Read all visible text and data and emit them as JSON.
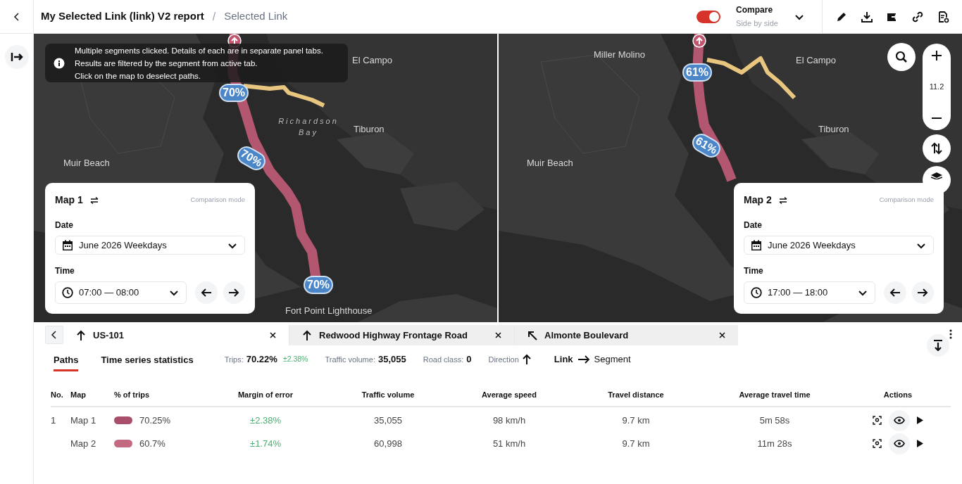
{
  "header": {
    "title": "My Selected Link (link) V2 report",
    "separator": "/",
    "breadcrumb": "Selected Link",
    "compare": {
      "on": true,
      "label": "Compare",
      "mode": "Side by side"
    }
  },
  "notice": {
    "lines": [
      "Multiple segments clicked. Details of each are in separate panel tabs.",
      "Results are filtered by the segment from active tab.",
      "Click on the map to deselect paths."
    ]
  },
  "maps": [
    {
      "name": "Map 1",
      "mode_label": "Comparison mode",
      "date_label": "Date",
      "date": "June 2026 Weekdays",
      "time_label": "Time",
      "time": "07:00 — 08:00",
      "places": [
        "El Campo",
        "Richardson Bay",
        "Tiburon",
        "Muir Beach",
        "Fort Point Lighthouse"
      ],
      "percent_labels": [
        "70%",
        "70%",
        "70%"
      ]
    },
    {
      "name": "Map 2",
      "mode_label": "Comparison mode",
      "date_label": "Date",
      "date": "June 2026 Weekdays",
      "time_label": "Time",
      "time": "17:00 — 18:00",
      "places": [
        "Miller Molino",
        "El Campo",
        "Tiburon",
        "Muir Beach"
      ],
      "percent_labels": [
        "61%",
        "61%"
      ]
    }
  ],
  "zoom_level": "11.2",
  "segment_tabs": [
    {
      "label": "US-101",
      "kind": "straight",
      "selected": true
    },
    {
      "label": "Redwood Highway Frontage Road",
      "kind": "straight",
      "selected": false
    },
    {
      "label": "Almonte Boulevard",
      "kind": "diagonal",
      "selected": false
    }
  ],
  "panel_tabs": [
    {
      "label": "Paths",
      "selected": true
    },
    {
      "label": "Time series statistics",
      "selected": false
    }
  ],
  "stats": [
    {
      "kind": "value",
      "label": "Trips:",
      "value": "70.22%",
      "extra": "±2.38%"
    },
    {
      "kind": "value",
      "label": "Traffic volume:",
      "value": "35,055"
    },
    {
      "kind": "value",
      "label": "Road class:",
      "value": "0"
    },
    {
      "kind": "direction",
      "label": "Direction"
    }
  ],
  "level_switch": {
    "from": "Link",
    "to": "Segment"
  },
  "table": {
    "columns": [
      "No.",
      "Map",
      "% of trips",
      "Margin of error",
      "Traffic volume",
      "Average speed",
      "Travel distance",
      "Average travel time",
      "Actions"
    ],
    "rows": [
      {
        "no": "1",
        "map": "Map 1",
        "color": "#a94f6c",
        "trips": "70.25%",
        "margin": "±2.38%",
        "volume": "35,055",
        "speed": "98 km/h",
        "distance": "9.7 km",
        "time": "5m 58s"
      },
      {
        "map": "Map 2",
        "color": "#c46a80",
        "trips": "60.7%",
        "margin": "±1.74%",
        "volume": "60,998",
        "speed": "51 km/h",
        "distance": "9.7 km",
        "time": "11m 28s"
      }
    ]
  }
}
